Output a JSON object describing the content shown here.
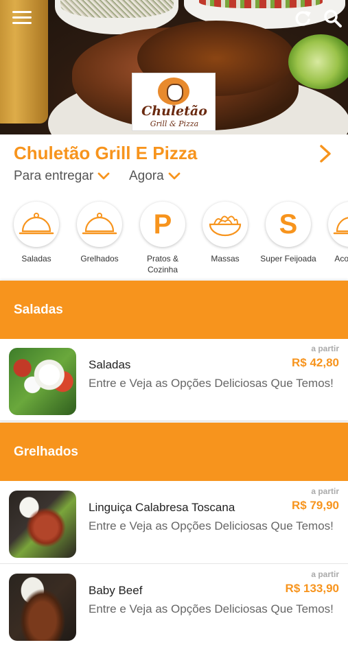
{
  "header": {
    "logo_name": "Chuletão",
    "logo_sub": "Grill & Pizza"
  },
  "store": {
    "name": "Chuletão Grill E Pizza",
    "delivery_mode": "Para entregar",
    "time": "Agora"
  },
  "categories": [
    {
      "label": "Saladas",
      "icon": "cloche-icon"
    },
    {
      "label": "Grelhados",
      "icon": "cloche-icon"
    },
    {
      "label": "Pratos & Cozinha",
      "icon": "letter-p-icon",
      "letter": "P"
    },
    {
      "label": "Massas",
      "icon": "pasta-bowl-icon"
    },
    {
      "label": "Super Feijoada",
      "icon": "letter-s-icon",
      "letter": "S"
    },
    {
      "label": "Acomp n",
      "icon": "cloche-icon"
    }
  ],
  "sections": [
    {
      "title": "Saladas",
      "items": [
        {
          "name": "Saladas",
          "description": "Entre e Veja as Opções Deliciosas Que Temos!",
          "from_label": "a partir",
          "price": "R$ 42,80"
        }
      ]
    },
    {
      "title": "Grelhados",
      "items": [
        {
          "name": "Linguiça Calabresa Toscana",
          "description": "Entre e Veja as Opções Deliciosas Que Temos!",
          "from_label": "a partir",
          "price": "R$ 79,90"
        },
        {
          "name": "Baby Beef",
          "description": "Entre e Veja as Opções Deliciosas Que Temos!",
          "from_label": "a partir",
          "price": "R$ 133,90"
        }
      ]
    }
  ],
  "colors": {
    "accent": "#f7941d",
    "text": "#222222",
    "muted": "#666666"
  }
}
